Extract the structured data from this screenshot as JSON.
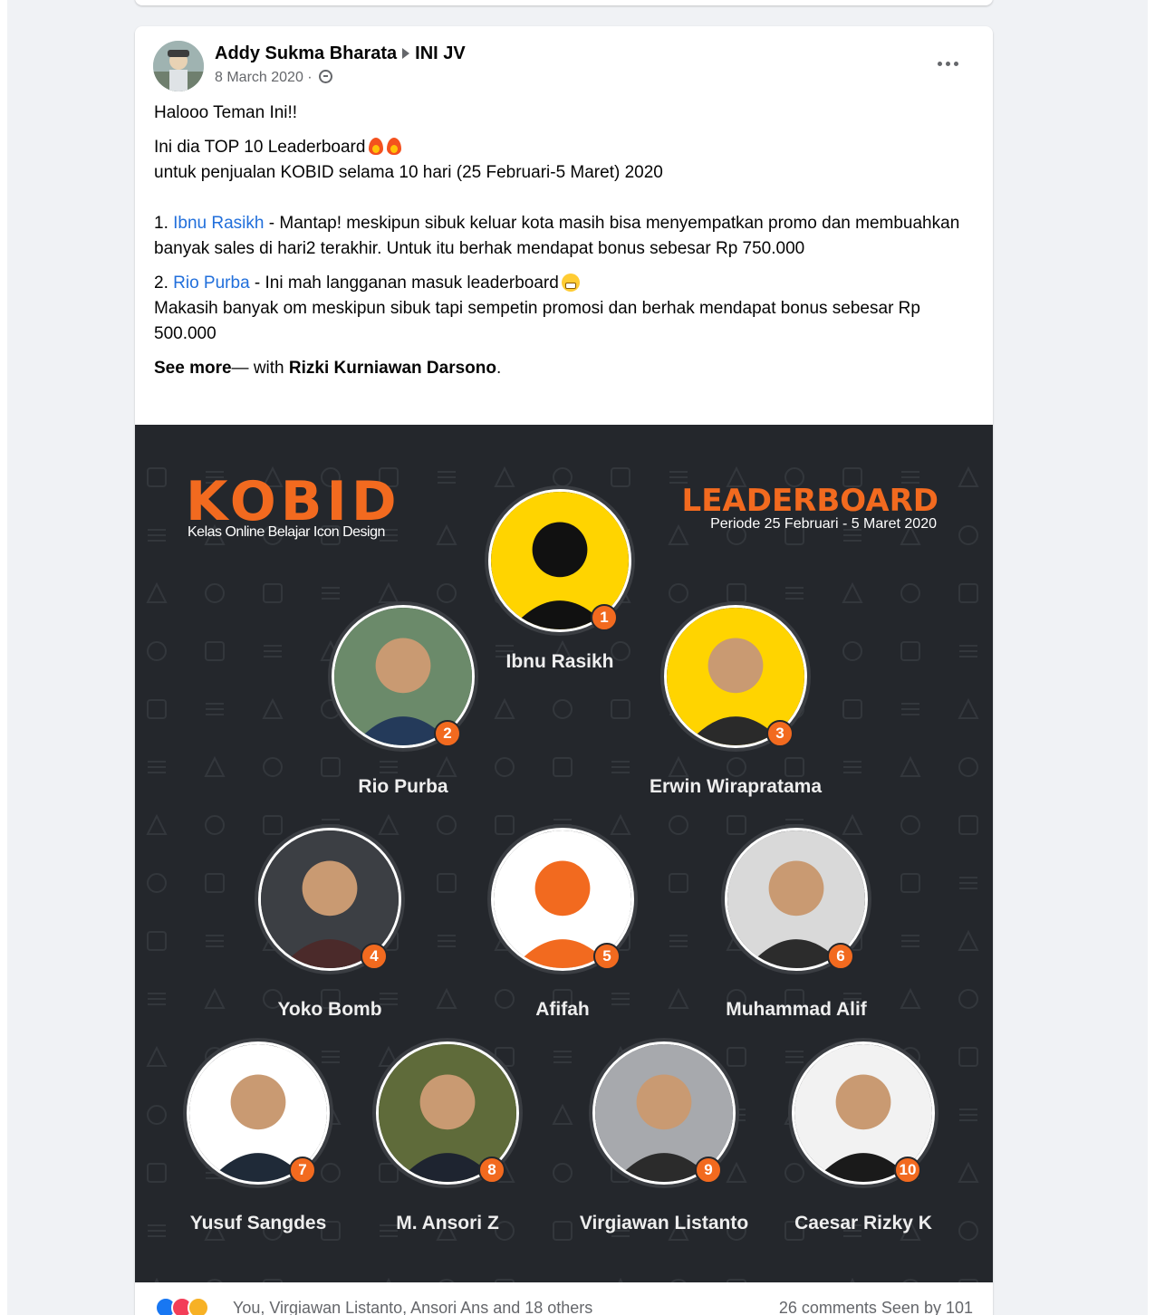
{
  "post": {
    "author": "Addy Sukma Bharata",
    "group": "INI JV",
    "date": "8 March 2020",
    "privacy_icon": "globe-icon",
    "more_icon": "more-horizontal-icon",
    "greeting": "Halooo Teman Ini!!",
    "line_top10": "Ini dia TOP 10 Leaderboard",
    "line_period": "untuk penjualan KOBID selama 10 hari (25 Februari-5 Maret) 2020",
    "item1_num": "1.",
    "item1_name": "Ibnu Rasikh",
    "item1_text": " - Mantap! meskipun sibuk keluar kota masih bisa menyempatkan promo dan membuahkan banyak sales di hari2 terakhir. Untuk itu berhak mendapat bonus sebesar Rp 750.000",
    "item2_num": "2.",
    "item2_name": "Rio Purba",
    "item2_text": " - Ini mah langganan masuk leaderboard",
    "item2_text2": "Makasih banyak om meskipun sibuk tapi sempetin promosi dan berhak mendapat bonus sebesar Rp 500.000",
    "see_more": "See more",
    "with_text": "— with ",
    "tagged": "Rizki Kurniawan Darsono",
    "tagged_end": "."
  },
  "image": {
    "brand_title": "KOBID",
    "brand_subtitle": "Kelas Online Belajar Icon Design",
    "leaderboard_title": "LEADERBOARD",
    "leaderboard_period": "Periode 25 Februari - 5 Maret 2020",
    "members": [
      {
        "rank": "1",
        "name": "Ibnu Rasikh"
      },
      {
        "rank": "2",
        "name": "Rio Purba"
      },
      {
        "rank": "3",
        "name": "Erwin Wirapratama"
      },
      {
        "rank": "4",
        "name": "Yoko Bomb"
      },
      {
        "rank": "5",
        "name": "Afifah"
      },
      {
        "rank": "6",
        "name": "Muhammad Alif"
      },
      {
        "rank": "7",
        "name": "Yusuf Sangdes"
      },
      {
        "rank": "8",
        "name": "M. Ansori Z"
      },
      {
        "rank": "9",
        "name": "Virgiawan Listanto"
      },
      {
        "rank": "10",
        "name": "Caesar Rizky K"
      }
    ]
  },
  "reactions": {
    "icons": [
      "like-icon",
      "love-icon",
      "haha-icon"
    ],
    "summary": "You, Virgiawan Listanto, Ansori Ans and 18 others",
    "stats": "26 comments  Seen by 101"
  },
  "colors": {
    "accent_orange": "#f26a1f",
    "link_blue": "#216fdb",
    "image_bg": "#24272c"
  }
}
